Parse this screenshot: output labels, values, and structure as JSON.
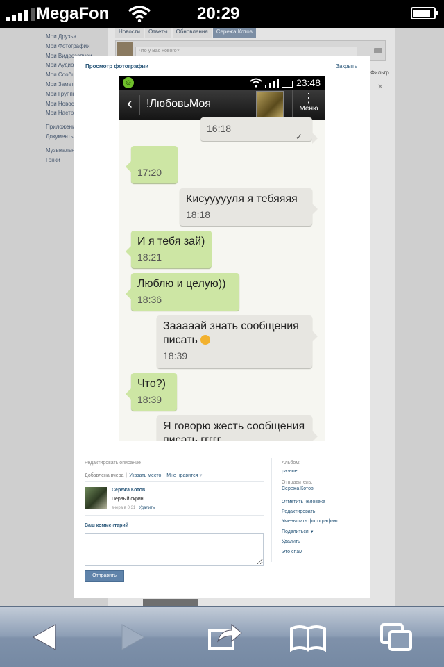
{
  "ios_status": {
    "carrier": "MegaFon",
    "time": "20:29"
  },
  "page": {
    "left_nav": [
      "Мои Друзья",
      "Мои Фотографии",
      "Мои Видеозаписи",
      "Мои Аудио",
      "Мои Сообщ",
      "Мои Заметк",
      "Мои Группы",
      "Мои Новост",
      "Мои Настро"
    ],
    "left_nav_extra": [
      "Приложения",
      "Документы"
    ],
    "left_nav_extra2": [
      "Музыкальн",
      "Гонки"
    ],
    "tabs": [
      "Новости",
      "Ответы",
      "Обновления",
      "Сережа Котов"
    ],
    "status_placeholder": "Что у Вас нового?",
    "filter": "Фильтр"
  },
  "modal": {
    "title": "Просмотр фотографии",
    "close": "Закрыть",
    "phone": {
      "time": "23:48",
      "contact": "!ЛюбовьМоя",
      "menu_label": "Меню",
      "messages": [
        {
          "dir": "out",
          "text": "",
          "time": "16:18"
        },
        {
          "dir": "in",
          "text": "",
          "time": "17:20"
        },
        {
          "dir": "out",
          "text": "Кисуууууля я тебяяяя",
          "time": "18:18"
        },
        {
          "dir": "in",
          "text": "И я тебя зай)",
          "time": "18:21"
        },
        {
          "dir": "in",
          "text": "Люблю и целую))",
          "time": "18:36"
        },
        {
          "dir": "out",
          "text": "Зааааай знать сообщения писать",
          "time": "18:39"
        },
        {
          "dir": "in",
          "text": "Что?)",
          "time": "18:39"
        },
        {
          "dir": "out",
          "text": "Я говорю жесть сообщения писать ггггг",
          "time": ""
        }
      ]
    },
    "edit_description": "Редактировать описание",
    "added": "Добавлена вчера",
    "show_place": "Указать место",
    "like": "Мне нравится",
    "comment": {
      "author": "Сережа Котов",
      "text": "Первый скрин",
      "when": "вчера в 0:31",
      "delete": "Удалить"
    },
    "your_comment_label": "Ваш комментарий",
    "send_button": "Отправить",
    "sidebar": {
      "album_label": "Альбом:",
      "album_value": "разное",
      "sender_label": "Отправитель:",
      "sender_value": "Сережа Котов",
      "actions": [
        "Отметить человека",
        "Редактировать",
        "Уменьшить фотографию",
        "Поделиться",
        "Удалить",
        "Это спам"
      ]
    }
  },
  "colors": {
    "vk_link": "#2b587a",
    "incoming_bubble": "#cde6a4",
    "outgoing_bubble": "#e7e6e1"
  },
  "toolbar": {
    "icons": [
      "back-arrow-icon",
      "forward-arrow-icon",
      "share-icon",
      "bookmarks-icon",
      "tabs-icon"
    ]
  }
}
